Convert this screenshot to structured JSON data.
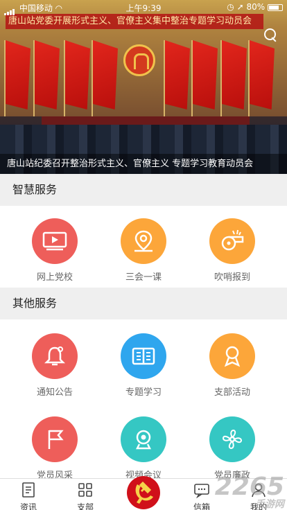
{
  "status_bar": {
    "carrier": "中国移动",
    "time": "上午9:39",
    "battery": "80%",
    "battery_level": 0.8
  },
  "banner": {
    "slogan": "唐山站党委开展形式主义、官僚主义集中整治专题学习动员会",
    "caption": "唐山站纪委召开整治形式主义、官僚主义 专题学习教育动员会"
  },
  "smart_services": {
    "title": "智慧服务",
    "items": [
      {
        "label": "网上党校",
        "icon": "video-play-icon",
        "color": "#ee5e5a"
      },
      {
        "label": "三会一课",
        "icon": "map-pin-icon",
        "color": "#fca63a"
      },
      {
        "label": "吹哨报到",
        "icon": "whistle-icon",
        "color": "#fca63a"
      }
    ]
  },
  "other_services": {
    "title": "其他服务",
    "items": [
      {
        "label": "通知公告",
        "icon": "bell-icon",
        "color": "#ee5e5a"
      },
      {
        "label": "专题学习",
        "icon": "book-icon",
        "color": "#2fa6ee"
      },
      {
        "label": "支部活动",
        "icon": "ribbon-icon",
        "color": "#fca63a"
      },
      {
        "label": "党员风采",
        "icon": "flag-icon",
        "color": "#ee5e5a"
      },
      {
        "label": "视频会议",
        "icon": "webcam-icon",
        "color": "#35c7c3"
      },
      {
        "label": "党员廉政",
        "icon": "fan-icon",
        "color": "#35c7c3"
      }
    ]
  },
  "tab_bar": {
    "items": [
      {
        "label": "资讯",
        "icon": "news-icon"
      },
      {
        "label": "支部",
        "icon": "grid-icon"
      },
      {
        "label": "",
        "icon": "party-emblem-icon"
      },
      {
        "label": "信箱",
        "icon": "message-icon"
      },
      {
        "label": "我的",
        "icon": "user-icon"
      }
    ]
  },
  "watermark": {
    "text": "2265",
    "sub": "手游网"
  }
}
